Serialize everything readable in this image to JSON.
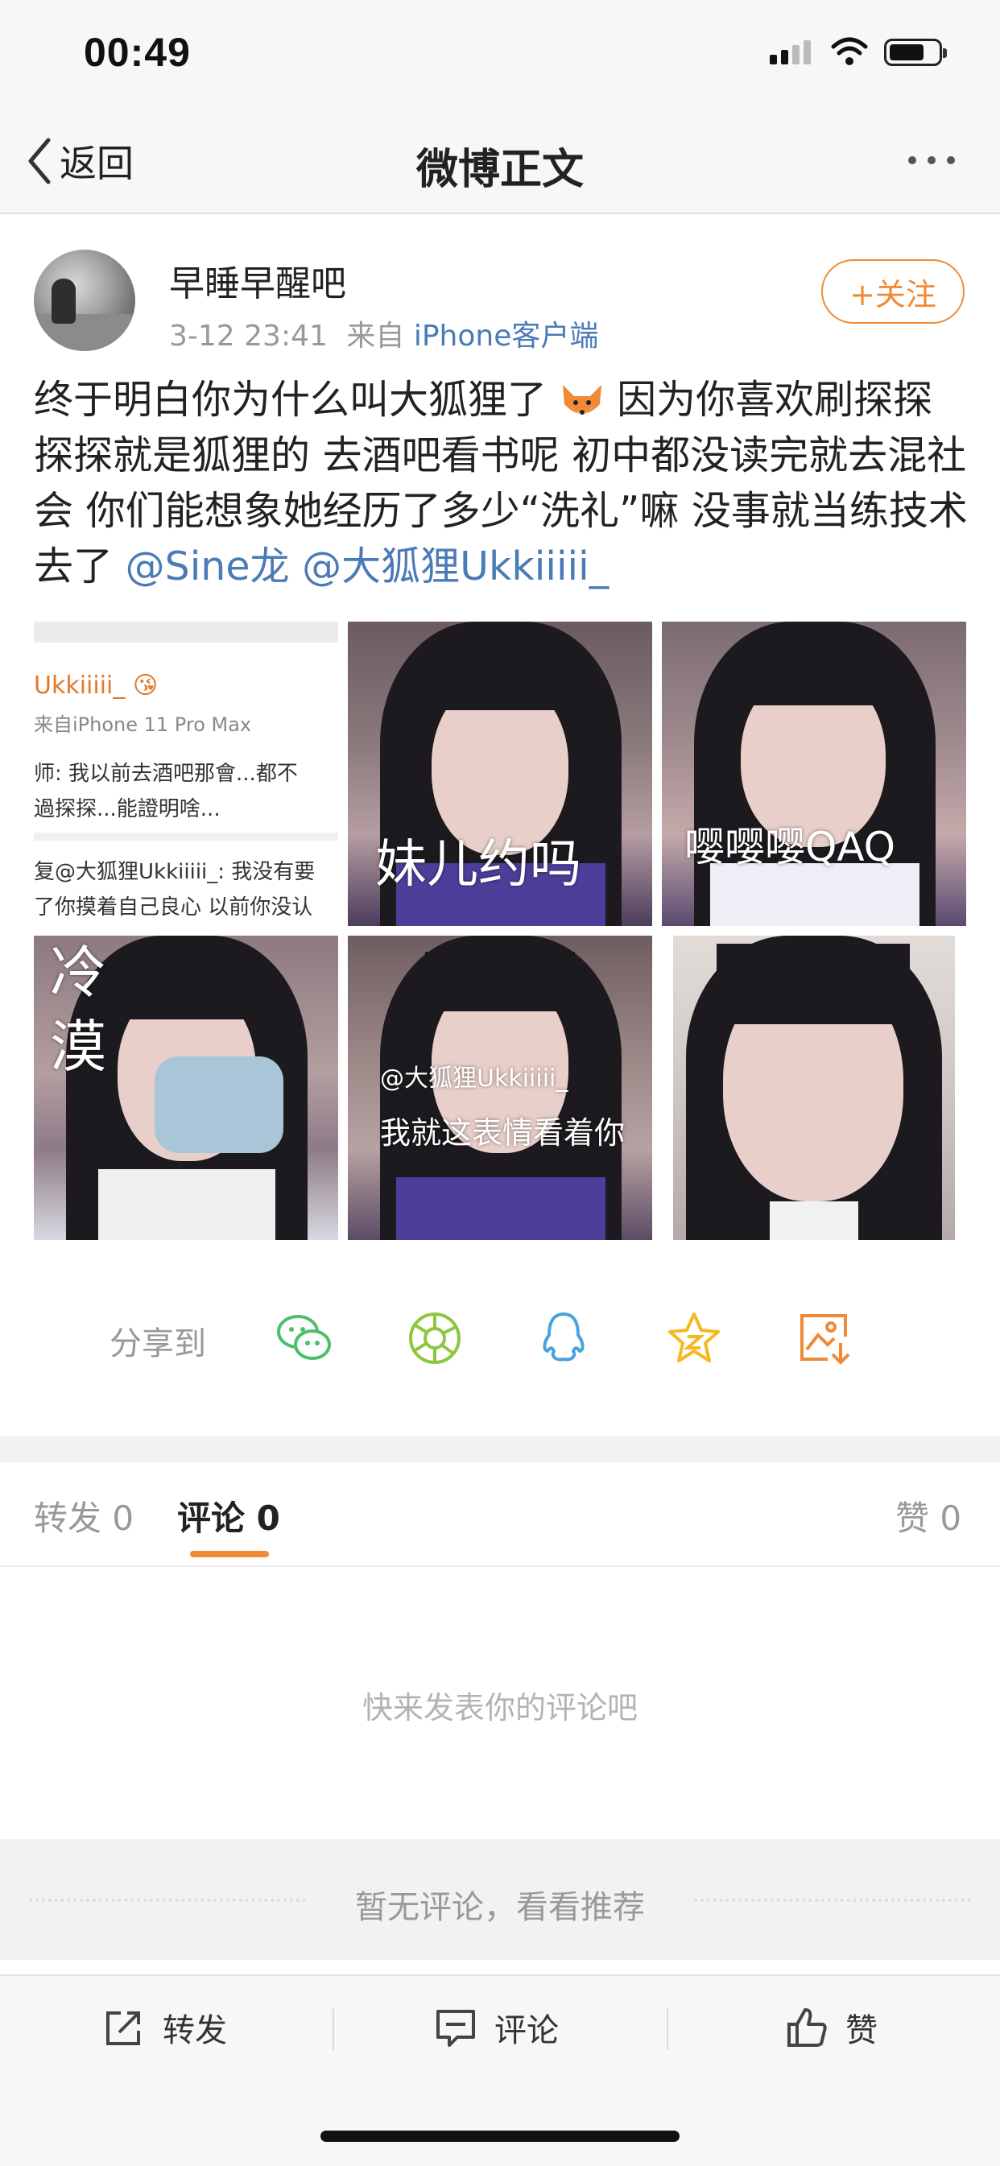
{
  "status_bar": {
    "time": "00:49"
  },
  "nav": {
    "back_label": "返回",
    "title": "微博正文"
  },
  "post": {
    "username": "早睡早醒吧",
    "time": "3-12 23:41",
    "source_prefix": "来自",
    "source": "iPhone客户端",
    "follow_label": "+关注",
    "text_lines": [
      "终于明白你为什么叫大狐狸了",
      "因为你喜欢刷探探",
      "探探就是狐狸的 去酒吧看书呢 初中都没读完就去混社",
      "会 你们能想象她经历了多少“洗礼”嘛 没事就当练技术",
      "去了"
    ],
    "mentions": [
      "@Sine龙",
      "@大狐狸Ukkiiiii_"
    ]
  },
  "images": {
    "screenshot": {
      "line1": "Ukkiiiii_ 😘",
      "line2": "来自iPhone 11 Pro Max",
      "line3": "师: 我以前去酒吧那會...都不",
      "line4": "過探探...能證明啥...",
      "line5": "复@大狐狸Ukkiiiii_: 我没有要",
      "line6": "了你摸着自己良心 以前你没认"
    },
    "captions": {
      "img2": "妹儿约吗",
      "img3": "嘤嘤嘤QAQ",
      "img4": "冷漠",
      "img5_watermark": "@大狐狸Ukkiiiii_",
      "img5": "我就这表情看着你"
    }
  },
  "share": {
    "label": "分享到",
    "icons": [
      "wechat-icon",
      "moments-icon",
      "qq-icon",
      "favorite-icon",
      "save-image-icon"
    ]
  },
  "tabs": {
    "repost_label": "转发",
    "repost_count": "0",
    "comment_label": "评论",
    "comment_count": "0",
    "like_label": "赞",
    "like_count": "0"
  },
  "comments": {
    "empty_hint": "快来发表你的评论吧",
    "recommend_text": "暂无评论，看看推荐"
  },
  "toolbar": {
    "repost_label": "转发",
    "comment_label": "评论",
    "like_label": "赞"
  },
  "colors": {
    "accent": "#f08a37",
    "link": "#4a7bb7"
  }
}
